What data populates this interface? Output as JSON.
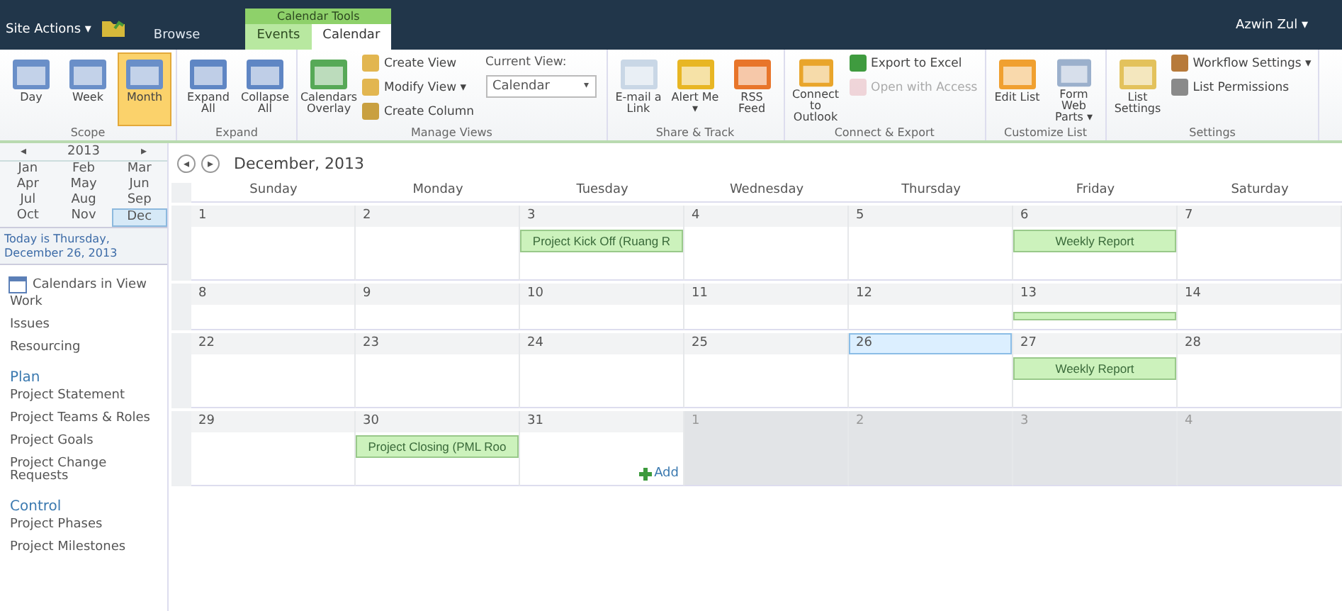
{
  "top_bar": {
    "site_actions": "Site Actions ▾",
    "tabs": [
      {
        "label": "Browse",
        "selected": false
      }
    ],
    "context_group": {
      "label": "Calendar Tools",
      "tabs": [
        {
          "label": "Events",
          "selected": false
        },
        {
          "label": "Calendar",
          "selected": true
        }
      ]
    },
    "user": "Azwin Zul ▾"
  },
  "ribbon": {
    "groups": [
      {
        "label": "Scope",
        "items": [
          {
            "kind": "large",
            "label": "Day",
            "selected": false
          },
          {
            "kind": "large",
            "label": "Week",
            "selected": false
          },
          {
            "kind": "large",
            "label": "Month",
            "selected": true
          }
        ]
      },
      {
        "label": "Expand",
        "items": [
          {
            "kind": "large",
            "label": "Expand All",
            "selected": false
          },
          {
            "kind": "large",
            "label": "Collapse All",
            "selected": false
          }
        ]
      },
      {
        "label": "Manage Views",
        "items": [
          {
            "kind": "large",
            "label": "Calendars Overlay",
            "selected": false
          },
          {
            "kind": "stack",
            "entries": [
              {
                "label": "Create View",
                "disabled": false
              },
              {
                "label": "Modify View ▾",
                "disabled": false
              },
              {
                "label": "Create Column",
                "disabled": false
              }
            ]
          },
          {
            "kind": "select",
            "label": "Current View:",
            "value": "Calendar",
            "caret": "▾"
          }
        ]
      },
      {
        "label": "Share & Track",
        "items": [
          {
            "kind": "large",
            "label": "E-mail a Link",
            "selected": false
          },
          {
            "kind": "large",
            "label": "Alert Me ▾",
            "selected": false
          },
          {
            "kind": "large",
            "label": "RSS Feed",
            "selected": false
          }
        ]
      },
      {
        "label": "Connect & Export",
        "items": [
          {
            "kind": "large",
            "label": "Connect to Outlook",
            "selected": false
          },
          {
            "kind": "stack",
            "entries": [
              {
                "label": "Export to Excel",
                "disabled": false
              },
              {
                "label": "Open with Access",
                "disabled": true
              }
            ]
          }
        ]
      },
      {
        "label": "Customize List",
        "items": [
          {
            "kind": "large",
            "label": "Edit List",
            "selected": false
          },
          {
            "kind": "large",
            "label": "Form Web Parts ▾",
            "selected": false
          }
        ]
      },
      {
        "label": "Settings",
        "items": [
          {
            "kind": "large",
            "label": "List Settings",
            "selected": false
          },
          {
            "kind": "stack",
            "entries": [
              {
                "label": "Workflow Settings ▾",
                "disabled": false
              },
              {
                "label": "List Permissions",
                "disabled": false
              }
            ]
          }
        ]
      }
    ]
  },
  "sidebar": {
    "year_picker": {
      "prev": "◂",
      "year": "2013",
      "next": "▸",
      "months": [
        {
          "label": "Jan",
          "selected": false
        },
        {
          "label": "Feb",
          "selected": false
        },
        {
          "label": "Mar",
          "selected": false
        },
        {
          "label": "Apr",
          "selected": false
        },
        {
          "label": "May",
          "selected": false
        },
        {
          "label": "Jun",
          "selected": false
        },
        {
          "label": "Jul",
          "selected": false
        },
        {
          "label": "Aug",
          "selected": false
        },
        {
          "label": "Sep",
          "selected": false
        },
        {
          "label": "Oct",
          "selected": false
        },
        {
          "label": "Nov",
          "selected": false
        },
        {
          "label": "Dec",
          "selected": true
        }
      ]
    },
    "today": "Today is Thursday, December 26, 2013",
    "calendars_heading": "Calendars in View",
    "sections": [
      {
        "items": [
          "Work",
          "Issues",
          "Resourcing"
        ]
      },
      {
        "heading": "Plan",
        "items": [
          "Project Statement",
          "Project Teams & Roles",
          "Project Goals",
          "Project Change Requests"
        ]
      },
      {
        "heading": "Control",
        "items": [
          "Project Phases",
          "Project Milestones"
        ]
      }
    ]
  },
  "calendar": {
    "prev": "◂",
    "next": "▸",
    "title": "December, 2013",
    "weekdays": [
      "Sunday",
      "Monday",
      "Tuesday",
      "Wednesday",
      "Thursday",
      "Friday",
      "Saturday"
    ],
    "weeks": [
      {
        "collapsed": false,
        "days": [
          {
            "number": "1",
            "other_month": false,
            "selected": false
          },
          {
            "number": "2",
            "other_month": false,
            "selected": false
          },
          {
            "number": "3",
            "other_month": false,
            "selected": false,
            "events": [
              {
                "title": "Project Kick Off (Ruang R"
              }
            ]
          },
          {
            "number": "4",
            "other_month": false,
            "selected": false
          },
          {
            "number": "5",
            "other_month": false,
            "selected": false
          },
          {
            "number": "6",
            "other_month": false,
            "selected": false,
            "events": [
              {
                "title": "Weekly Report"
              }
            ]
          },
          {
            "number": "7",
            "other_month": false,
            "selected": false
          }
        ]
      },
      {
        "collapsed": true,
        "days": [
          {
            "number": "8",
            "other_month": false,
            "selected": false
          },
          {
            "number": "9",
            "other_month": false,
            "selected": false
          },
          {
            "number": "10",
            "other_month": false,
            "selected": false
          },
          {
            "number": "11",
            "other_month": false,
            "selected": false
          },
          {
            "number": "12",
            "other_month": false,
            "selected": false
          },
          {
            "number": "13",
            "other_month": false,
            "selected": false,
            "events": [
              {
                "kind": "clipped"
              }
            ]
          },
          {
            "number": "14",
            "other_month": false,
            "selected": false
          }
        ]
      },
      {
        "collapsed": false,
        "days": [
          {
            "number": "22",
            "other_month": false,
            "selected": false
          },
          {
            "number": "23",
            "other_month": false,
            "selected": false
          },
          {
            "number": "24",
            "other_month": false,
            "selected": false
          },
          {
            "number": "25",
            "other_month": false,
            "selected": false
          },
          {
            "number": "26",
            "other_month": false,
            "selected": true
          },
          {
            "number": "27",
            "other_month": false,
            "selected": false,
            "events": [
              {
                "title": "Weekly Report"
              }
            ]
          },
          {
            "number": "28",
            "other_month": false,
            "selected": false
          }
        ]
      },
      {
        "collapsed": false,
        "days": [
          {
            "number": "29",
            "other_month": false,
            "selected": false
          },
          {
            "number": "30",
            "other_month": false,
            "selected": false,
            "events": [
              {
                "title": "Project Closing (PML Roo"
              }
            ]
          },
          {
            "number": "31",
            "other_month": false,
            "selected": false,
            "add": "Add"
          },
          {
            "number": "1",
            "other_month": true,
            "selected": false
          },
          {
            "number": "2",
            "other_month": true,
            "selected": false
          },
          {
            "number": "3",
            "other_month": true,
            "selected": false
          },
          {
            "number": "4",
            "other_month": true,
            "selected": false
          }
        ]
      }
    ]
  }
}
